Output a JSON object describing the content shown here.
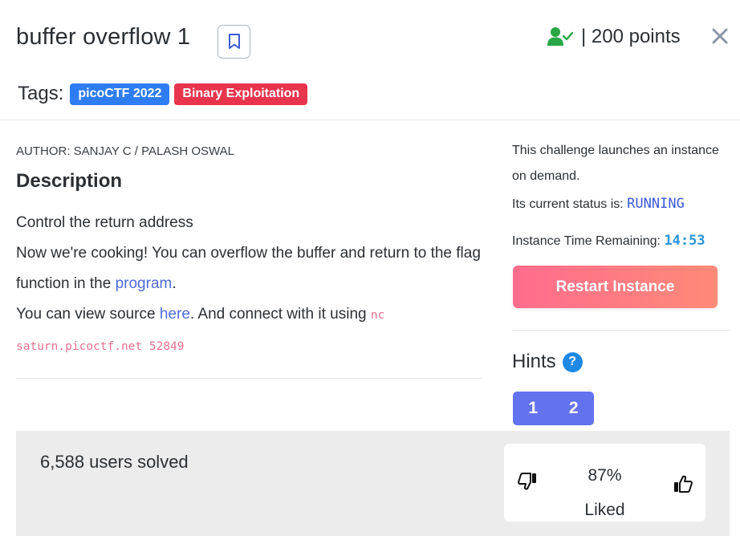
{
  "challenge": {
    "title": "buffer overflow 1",
    "points": "| 200 points",
    "tags_label": "Tags:",
    "tags": [
      {
        "label": "picoCTF 2022",
        "color": "#2f7df2"
      },
      {
        "label": "Binary Exploitation",
        "color": "#e8344d"
      }
    ],
    "author": "AUTHOR: SANJAY C / PALASH OSWAL",
    "description_heading": "Description",
    "description": {
      "line1": "Control the return address",
      "line2_prefix": "Now we're cooking! You can overflow the buffer and return to the flag function in the ",
      "program_link": "program",
      "line2_suffix": ".",
      "line3_prefix": "You can view source ",
      "here_link": "here",
      "line3_mid": ". And connect with it using ",
      "command": "nc saturn.picoctf.net 52849"
    }
  },
  "instance": {
    "launch_text": "This challenge launches an instance on demand.",
    "status_label": "Its current status is:",
    "status": "RUNNING",
    "time_label": "Instance Time Remaining:",
    "time_remaining": "14:53",
    "restart_label": "Restart Instance"
  },
  "hints": {
    "label": "Hints",
    "help_icon": "question-circle-icon",
    "buttons": [
      "1",
      "2"
    ]
  },
  "stats": {
    "solved": "6,588 users solved",
    "liked_percent": "87%",
    "liked_label": "Liked"
  },
  "colors": {
    "accent_blue": "#1e88e5",
    "restart_gradient_start": "#ff6c8d",
    "restart_gradient_end": "#ff8a78",
    "hint_button": "#6372ef",
    "solved_check": "#28a745"
  }
}
